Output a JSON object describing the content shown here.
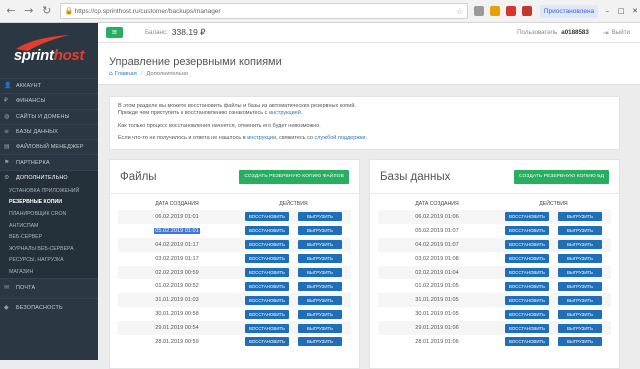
{
  "browser": {
    "url": "https://cp.sprinthost.ru/customer/backups/manager",
    "profile": "Приостановлена",
    "icons": [
      "back-icon",
      "forward-icon",
      "reload-icon",
      "lock-icon",
      "star-icon"
    ],
    "window": {
      "minimize": "–",
      "maximize": "□",
      "close": "✕"
    }
  },
  "brand": {
    "name_part1": "sprint",
    "name_part2": "host",
    "accent": "#e43d2a"
  },
  "sidebar": {
    "items": [
      {
        "label": "Аккаунт",
        "icon": "person-icon"
      },
      {
        "label": "Финансы",
        "icon": "money-icon"
      },
      {
        "label": "Сайты и домены",
        "icon": "globe-icon"
      },
      {
        "label": "Базы данных",
        "icon": "database-icon"
      },
      {
        "label": "Файловый менеджер",
        "icon": "folder-icon"
      },
      {
        "label": "Партнерка",
        "icon": "partner-icon"
      },
      {
        "label": "Дополнительно",
        "icon": "gear-icon"
      }
    ],
    "subitems": [
      "Установка приложений",
      "Резервные копии",
      "Планировщик CRON",
      "Антиспам",
      "Веб-сервер",
      "Журналы веб-сервера",
      "Ресурсы, нагрузка",
      "Магазин"
    ],
    "bottom_items": [
      {
        "label": "Почта",
        "icon": "mail-icon"
      },
      {
        "label": "Безопасность",
        "icon": "shield-icon"
      }
    ]
  },
  "topbar": {
    "menu_icon": "≡",
    "balance_label": "Баланс:",
    "balance_value": "338.19 ₽",
    "user_label": "Пользователь",
    "user_value": "a0188583",
    "logout": "Выйти"
  },
  "header": {
    "title": "Управление резервными копиями",
    "breadcrumb_home": "Главная",
    "breadcrumb_sep": "/",
    "breadcrumb_current": "Дополнительно"
  },
  "info": {
    "p1_a": "В этом разделе вы можете восстановить файлы и базы из автоматических резервных копий.",
    "p1_b": "Прежде чем приступить к восстановлению ознакомьтесь с ",
    "p1_link": "инструкцией",
    "p1_end": ".",
    "p2": "Как только процесс восстановления начнется, отменить его будет невозможно.",
    "p3_a": "Если что-то не получилось и ответа не нашлось в ",
    "p3_link1": "инструкции",
    "p3_b": ", свяжитесь со ",
    "p3_link2": "службой поддержки",
    "p3_end": "."
  },
  "files": {
    "title": "Файлы",
    "create": "Создать резервную копию файлов",
    "col_date": "Дата создания",
    "col_actions": "Действия",
    "restore": "Восстановить",
    "download": "Выгрузить",
    "rows": [
      "06.02.2019 01:01",
      "05.02.2019 01:01",
      "04.02.2019 01:17",
      "03.02.2019 01:17",
      "02.02.2019 00:59",
      "01.02.2019 00:52",
      "31.01.2019 01:03",
      "30.01.2019 00:58",
      "29.01.2019 00:54",
      "28.01.2019 00:59"
    ]
  },
  "databases": {
    "title": "Базы данных",
    "create": "Создать резервную копию БД",
    "col_date": "Дата создания",
    "col_actions": "Действия",
    "restore": "Восстановить",
    "download": "Выгрузить",
    "rows": [
      "06.02.2019 01:06",
      "05.02.2019 01:07",
      "04.02.2019 01:07",
      "03.02.2019 01:08",
      "02.02.2019 01:04",
      "01.02.2019 01:05",
      "31.01.2019 01:05",
      "30.01.2019 01:05",
      "29.01.2019 01:06",
      "28.01.2019 01:06"
    ]
  }
}
